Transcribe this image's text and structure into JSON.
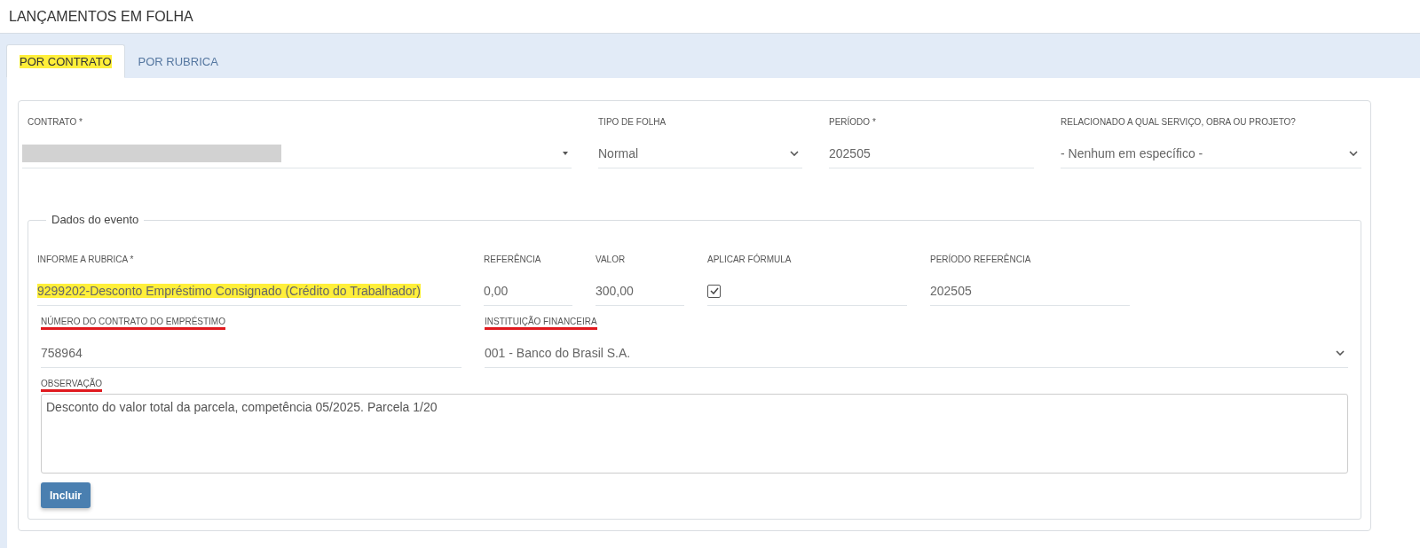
{
  "page_title": "LANÇAMENTOS EM FOLHA",
  "tabs": [
    {
      "label": "POR CONTRATO",
      "selected": true,
      "highlighted": true
    },
    {
      "label": "POR RUBRICA",
      "selected": false,
      "highlighted": false
    }
  ],
  "top_fields": [
    {
      "label": "CONTRATO *",
      "kind": "redacted"
    },
    {
      "label": "TIPO DE FOLHA",
      "kind": "select",
      "value": "Normal"
    },
    {
      "label": "PERÍODO *",
      "kind": "text",
      "value": "202505"
    },
    {
      "label": "RELACIONADO A QUAL SERVIÇO, OBRA OU PROJETO?",
      "kind": "select",
      "value": "- Nenhum em específico -"
    }
  ],
  "event": {
    "legend": "Dados do evento",
    "row_1": [
      {
        "label": "INFORME A RUBRICA *",
        "kind": "text",
        "value": "9299202-Desconto Empréstimo Consignado (Crédito do Trabalhador)",
        "highlighted": true
      },
      {
        "label": "REFERÊNCIA",
        "kind": "text",
        "value": "0,00",
        "highlighted": false
      },
      {
        "label": "VALOR",
        "kind": "text",
        "value": "300,00",
        "highlighted": false
      },
      {
        "label": "APLICAR FÓRMULA",
        "kind": "checkbox",
        "checked": true
      },
      {
        "label": "PERÍODO REFERÊNCIA",
        "kind": "text",
        "value": "202505",
        "highlighted": false
      }
    ],
    "row_2": [
      {
        "label": "NÚMERO DO CONTRATO DO EMPRÉSTIMO",
        "underlined": true,
        "kind": "text",
        "value": "758964"
      },
      {
        "label": "INSTITUIÇÃO FINANCEIRA",
        "underlined": true,
        "kind": "select",
        "value": "001 - Banco do Brasil S.A."
      }
    ],
    "observation": {
      "label": "OBSERVAÇÃO",
      "underlined": true,
      "value": "Desconto do valor total da parcela, competência 05/2025. Parcela 1/20"
    },
    "button": "Incluir"
  }
}
